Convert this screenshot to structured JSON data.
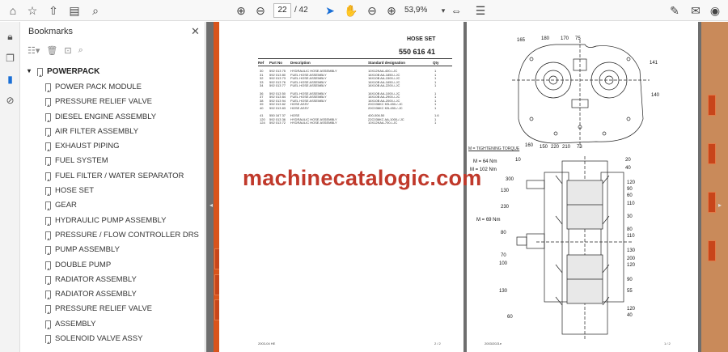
{
  "toolbar": {
    "page_current": "22",
    "page_total": "/ 42",
    "zoom": "53,9%",
    "icons": [
      "star-icon",
      "upload-icon",
      "print-icon",
      "zoom-icon",
      "prev-page-icon",
      "next-page-icon",
      "select-icon",
      "hand-icon",
      "zoom-out-icon",
      "zoom-in-icon",
      "fit-page-icon",
      "sign-icon",
      "email-icon",
      "account-icon"
    ]
  },
  "bookmarks": {
    "title": "Bookmarks",
    "root": "POWERPACK",
    "items": [
      "POWER PACK MODULE",
      "PRESSURE RELIEF VALVE",
      "DIESEL ENGINE ASSEMBLY",
      "AIR FILTER ASSEMBLY",
      "EXHAUST PIPING",
      "FUEL SYSTEM",
      "FUEL FILTER / WATER SEPARATOR",
      "HOSE SET",
      "GEAR",
      "HYDRAULIC PUMP ASSEMBLY",
      "PRESSURE / FLOW CONTROLLER DRS",
      "PUMP ASSEMBLY",
      "DOUBLE PUMP",
      "RADIATOR ASSEMBLY",
      "RADIATOR ASSEMBLY",
      "PRESSURE RELIEF VALVE",
      "ASSEMBLY",
      "SOLENOID VALVE ASSY"
    ]
  },
  "left_page": {
    "title": "HOSE SET",
    "number": "550 616 41",
    "headers": [
      "Ref",
      "Part No",
      "Description",
      "Standard designation",
      "Qty"
    ],
    "rows": [
      [
        "30",
        "592 013 75",
        "HYDRAULIC HOSE ASSEMBLY",
        "10X12KAA-400-/-JC",
        "1"
      ],
      [
        "31",
        "592 013 80",
        "FUEL HOSE ASSEMBLY",
        "16X10B AA-1850-/-JC",
        "1"
      ],
      [
        "32",
        "592 013 73",
        "FUEL HOSE ASSEMBLY",
        "16X10B AA-1500-/-JC",
        "1"
      ],
      [
        "33",
        "592 013 76",
        "FUEL HOSE ASSEMBLY",
        "16X10B AA-1650-/-JC",
        "1"
      ],
      [
        "34",
        "592 013 77",
        "FUEL HOSE ASSEMBLY",
        "16X10B AA-2200-/-JC",
        "1"
      ],
      [
        "",
        "",
        "",
        "",
        ""
      ],
      [
        "36",
        "592 013 50",
        "FUEL HOSE ASSEMBLY",
        "16X10B AA-1000-/-JC",
        "1"
      ],
      [
        "37",
        "592 013 84",
        "FUEL HOSE ASSEMBLY",
        "16X10B AA-2900-/-JC",
        "1"
      ],
      [
        "38",
        "592 013 94",
        "FUEL HOSE ASSEMBLY",
        "16X10B AA-2000-/-JC",
        "1"
      ],
      [
        "39",
        "592 013 82",
        "HOSE ASSY",
        "20C036KC KB-450-/-JC",
        "1"
      ],
      [
        "40",
        "592 013 83",
        "HOSE ASSY",
        "20C036KC KB-450-/-JC",
        "1"
      ],
      [
        "",
        "",
        "",
        "",
        ""
      ],
      [
        "41",
        "550 167 37",
        "HOSE",
        "400-006.50",
        "1.6"
      ],
      [
        "120",
        "592 013 36",
        "HYDRAULIC HOSE ASSEMBLY",
        "22C036KC AA-1000-/-JC",
        "1"
      ],
      [
        "124",
        "592 013 72",
        "HYDRAULIC HOSE ASSEMBLY",
        "10X12KAA-700-/-JC",
        "1"
      ]
    ],
    "footer_left": "2003-04 HE",
    "footer_right": "2 / 2"
  },
  "right_page": {
    "torque_note": "M = TIGHTENING TORQUE",
    "torques": [
      "M = 64 Nm",
      "M = 102 Nm",
      "M = 69 Nm"
    ],
    "top_callouts": [
      "165",
      "180",
      "170",
      "75",
      "141",
      "140",
      "160",
      "150",
      "220",
      "210",
      "73"
    ],
    "bottom_left_callouts": [
      "10",
      "300",
      "130",
      "230",
      "80",
      "70",
      "100",
      "130",
      "60"
    ],
    "bottom_right_callouts": [
      "20",
      "40",
      "120",
      "90",
      "60",
      "110",
      "30",
      "80",
      "110",
      "130",
      "200",
      "120",
      "90",
      "55",
      "120",
      "40"
    ],
    "footer_left": "2003/2021e",
    "footer_right": "1 / 2"
  },
  "watermark": "machinecatalogic.com",
  "colors": {
    "accent": "#d9541c",
    "watermark": "#c0392b",
    "doc_bg": "#6e6e6e"
  }
}
